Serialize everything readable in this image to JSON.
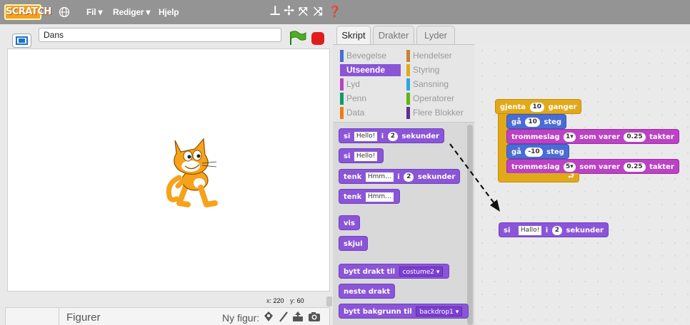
{
  "topbar": {
    "logo": "SCRATCH",
    "menu": [
      "Fil ▾",
      "Rediger ▾",
      "Hjelp"
    ],
    "tools": [
      "duplicate-icon",
      "delete-icon",
      "grow-icon",
      "shrink-icon",
      "help-icon"
    ]
  },
  "stage": {
    "project_title": "Dans",
    "coords": {
      "x_label": "x:",
      "x": "220",
      "y_label": "y:",
      "y": "60"
    }
  },
  "sprites": {
    "label": "Figurer",
    "new_sprite_label": "Ny figur:",
    "new_sprite_icons": [
      "library-sprite-icon",
      "paint-sprite-icon",
      "upload-sprite-icon",
      "camera-sprite-icon"
    ]
  },
  "tabs": [
    "Skript",
    "Drakter",
    "Lyder"
  ],
  "categories": [
    {
      "label": "Bevegelse",
      "color": "#4a6cd4"
    },
    {
      "label": "Hendelser",
      "color": "#c88330"
    },
    {
      "label": "Utseende",
      "color": "#8a55d7",
      "selected": true
    },
    {
      "label": "Styring",
      "color": "#e1a91a"
    },
    {
      "label": "Lyd",
      "color": "#bb42c3"
    },
    {
      "label": "Sansning",
      "color": "#2ca5e2"
    },
    {
      "label": "Penn",
      "color": "#0e9a6c"
    },
    {
      "label": "Operatorer",
      "color": "#5cb712"
    },
    {
      "label": "Data",
      "color": "#ee7d16"
    },
    {
      "label": "Flere Blokker",
      "color": "#632d99"
    }
  ],
  "palette_blocks": {
    "say_secs": {
      "pre": "si",
      "text": "Hello!",
      "mid": "i",
      "num": "2",
      "post": "sekunder"
    },
    "say": {
      "pre": "si",
      "text": "Hello!"
    },
    "think_secs": {
      "pre": "tenk",
      "text": "Hmm...",
      "mid": "i",
      "num": "2",
      "post": "sekunder"
    },
    "think": {
      "pre": "tenk",
      "text": "Hmm..."
    },
    "show": "vis",
    "hide": "skjul",
    "switch_costume": {
      "pre": "bytt drakt til",
      "value": "costume2"
    },
    "next_costume": "neste drakt",
    "switch_backdrop": {
      "pre": "bytt bakgrunn til",
      "value": "backdrop1"
    }
  },
  "script": {
    "repeat": {
      "pre": "gjenta",
      "num": "10",
      "post": "ganger"
    },
    "move1": {
      "pre": "gå",
      "num": "10",
      "post": "steg"
    },
    "drum1": {
      "pre": "trommeslag",
      "num": "1",
      "mid": "som varer",
      "beats": "0.25",
      "post": "takter"
    },
    "move2": {
      "pre": "gå",
      "num": "-10",
      "post": "steg"
    },
    "drum2": {
      "pre": "trommeslag",
      "num": "5",
      "mid": "som varer",
      "beats": "0.25",
      "post": "takter"
    },
    "say_secs": {
      "pre": "si",
      "text": "Hallo!",
      "mid": "i",
      "num": "2",
      "post": "sekunder"
    }
  }
}
